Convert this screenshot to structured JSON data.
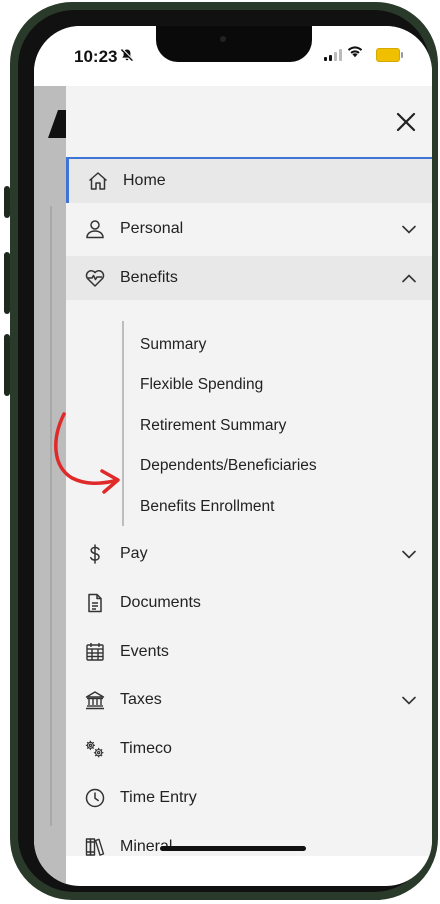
{
  "status_bar": {
    "time": "10:23",
    "silent_icon": "bell-slash-icon",
    "signal_icon": "cellular-signal-icon",
    "wifi_icon": "wifi-icon",
    "battery_icon": "battery-icon",
    "battery_color": "#f0c000"
  },
  "drawer": {
    "close_icon": "close-icon",
    "accent_color": "#3d74d6",
    "items": [
      {
        "label": "Home",
        "icon": "home-icon",
        "expandable": false,
        "active": true
      },
      {
        "label": "Personal",
        "icon": "person-icon",
        "expandable": true,
        "expanded": false
      },
      {
        "label": "Benefits",
        "icon": "heartbeat-icon",
        "expandable": true,
        "expanded": true,
        "children": [
          {
            "label": "Summary"
          },
          {
            "label": "Flexible Spending"
          },
          {
            "label": "Retirement Summary"
          },
          {
            "label": "Dependents/Beneficiaries"
          },
          {
            "label": "Benefits Enrollment"
          }
        ]
      },
      {
        "label": "Pay",
        "icon": "dollar-icon",
        "expandable": true,
        "expanded": false
      },
      {
        "label": "Documents",
        "icon": "document-icon",
        "expandable": false
      },
      {
        "label": "Events",
        "icon": "calendar-icon",
        "expandable": false
      },
      {
        "label": "Taxes",
        "icon": "bank-icon",
        "expandable": true,
        "expanded": false
      },
      {
        "label": "Timeco",
        "icon": "gears-icon",
        "expandable": false
      },
      {
        "label": "Time Entry",
        "icon": "clock-icon",
        "expandable": false
      },
      {
        "label": "Mineral",
        "icon": "books-icon",
        "expandable": false
      }
    ]
  },
  "annotation": {
    "icon": "curved-arrow-icon",
    "color": "#e02a2a"
  }
}
